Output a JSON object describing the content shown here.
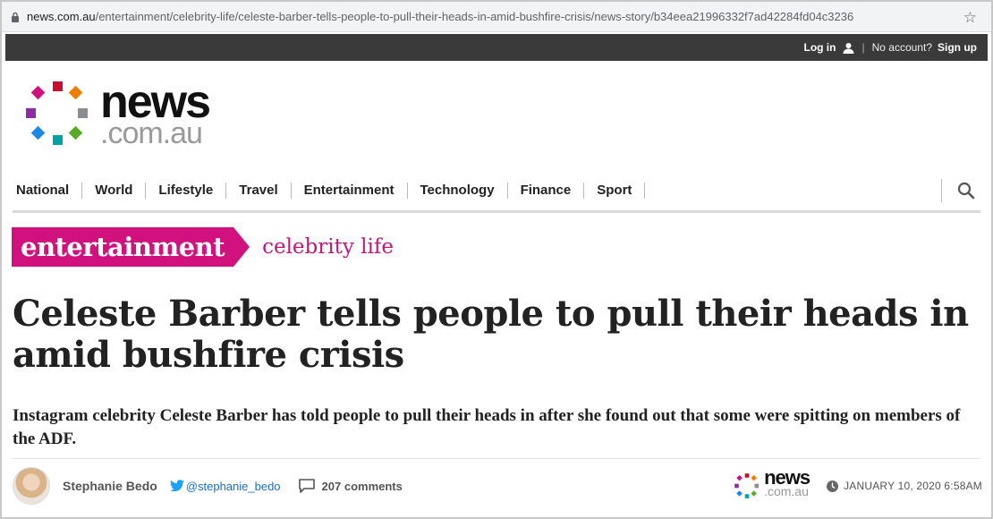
{
  "browser": {
    "url_domain": "news.com.au",
    "url_path": "/entertainment/celebrity-life/celeste-barber-tells-people-to-pull-their-heads-in-amid-bushfire-crisis/news-story/b34eea21996332f7ad42284fd04c3236"
  },
  "topbar": {
    "login": "Log in",
    "no_account": "No account?",
    "signup": "Sign up"
  },
  "logo": {
    "word1": "news",
    "word2": ".com.au",
    "colors": [
      "#c8102e",
      "#ef7d00",
      "#8a8d8f",
      "#5aaa2a",
      "#00a3a6",
      "#1e88e5",
      "#8e2ca6",
      "#d1127e"
    ]
  },
  "nav": {
    "items": [
      "National",
      "World",
      "Lifestyle",
      "Travel",
      "Entertainment",
      "Technology",
      "Finance",
      "Sport"
    ]
  },
  "section": {
    "primary": "entertainment",
    "secondary": "celebrity life",
    "color": "#d1127e"
  },
  "article": {
    "headline": "Celeste Barber tells people to pull their heads in amid bushfire crisis",
    "standfirst": "Instagram celebrity Celeste Barber has told people to pull their heads in after she found out that some were spitting on members of the ADF.",
    "author": "Stephanie Bedo",
    "twitter": "@stephanie_bedo",
    "comments": "207 comments",
    "publisher_word1": "news",
    "publisher_word2": ".com.au",
    "date": "JANUARY 10, 2020 6:58AM"
  }
}
